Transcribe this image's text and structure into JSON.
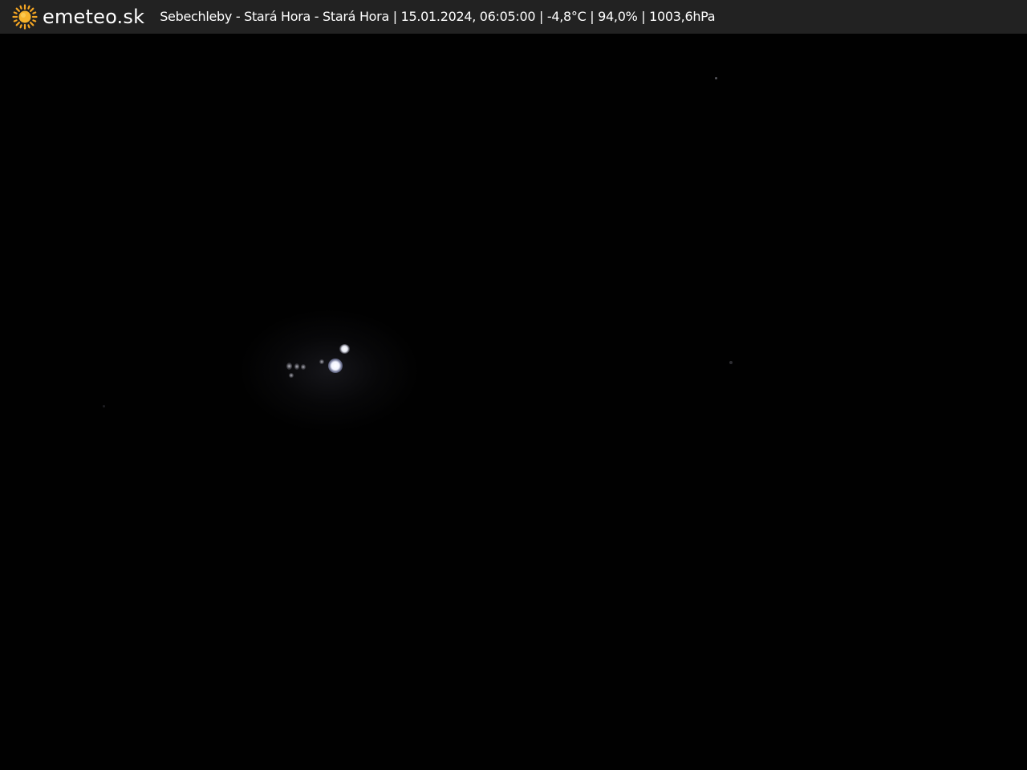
{
  "header": {
    "brand": "emeteo.sk",
    "logo_icon": "sun-icon",
    "caption": "Sebechleby - Stará Hora - Stará Hora | 15.01.2024, 06:05:00 | -4,8°C | 94,0% | 1003,6hPa"
  },
  "colors": {
    "header_background": "#222222",
    "sun": "#f5a623",
    "text": "#ffffff",
    "scene": "#010101"
  }
}
